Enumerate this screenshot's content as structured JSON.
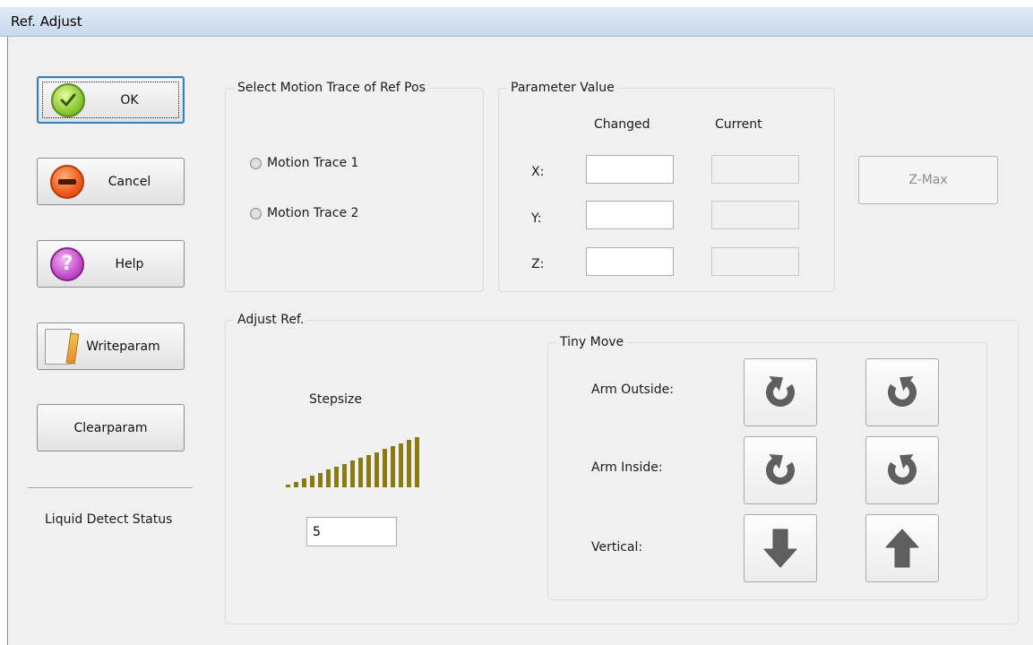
{
  "window": {
    "title": "Ref. Adjust"
  },
  "side_buttons": {
    "ok": "OK",
    "cancel": "Cancel",
    "help": "Help",
    "writeparam": "Writeparam",
    "clearparam": "Clearparam"
  },
  "liquid_detect_status": "Liquid Detect Status",
  "motion_trace_group": {
    "title": "Select Motion Trace of Ref Pos",
    "options": [
      "Motion Trace 1",
      "Motion Trace 2"
    ]
  },
  "parameter_group": {
    "title": "Parameter Value",
    "col_changed": "Changed",
    "col_current": "Current",
    "rows": [
      {
        "label": "X:",
        "changed": "",
        "current": ""
      },
      {
        "label": "Y:",
        "changed": "",
        "current": ""
      },
      {
        "label": "Z:",
        "changed": "",
        "current": ""
      }
    ]
  },
  "zmax_button": "Z-Max",
  "adjust_group": {
    "title": "Adjust Ref.",
    "stepsize_label": "Stepsize",
    "stepsize_value": "5",
    "step_bar_count": 17
  },
  "tiny_move_group": {
    "title": "Tiny Move",
    "rows": [
      {
        "label": "Arm Outside:",
        "left_icon": "rotate-cw-icon",
        "right_icon": "rotate-ccw-icon"
      },
      {
        "label": "Arm Inside:",
        "left_icon": "rotate-cw-icon",
        "right_icon": "rotate-ccw-icon"
      },
      {
        "label": "Vertical:",
        "left_icon": "arrow-down-icon",
        "right_icon": "arrow-up-icon"
      }
    ]
  },
  "colors": {
    "dialog_bg": "#f0f0f0",
    "step_bar": "#8b7a12",
    "icon_gray": "#5f5f5f"
  }
}
